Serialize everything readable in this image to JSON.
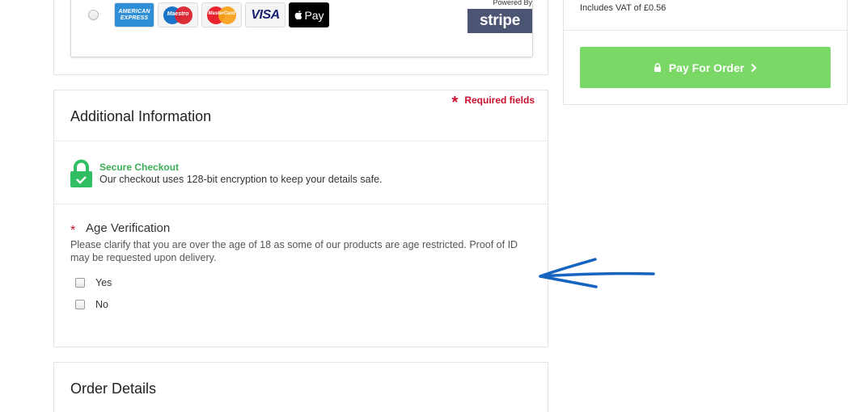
{
  "payment": {
    "cards": [
      {
        "name": "American Express",
        "line1": "AMERICAN",
        "line2": "EXPRESS"
      },
      {
        "name": "Maestro",
        "label": "Maestro"
      },
      {
        "name": "MasterCard",
        "label": "MasterCard"
      },
      {
        "name": "Visa",
        "label": "VISA"
      },
      {
        "name": "Apple Pay",
        "label": "Pay"
      }
    ],
    "powered_by": "Powered By",
    "stripe_label": "stripe"
  },
  "summary": {
    "vat_text": "Includes VAT of £0.56",
    "pay_button": "Pay For Order"
  },
  "additional_info": {
    "title": "Additional Information",
    "required_text": "Required fields",
    "secure_title": "Secure Checkout",
    "secure_text": "Our checkout uses 128-bit encryption to keep your details safe.",
    "age_title": "Age Verification",
    "age_description": "Please clarify that you are over the age of 18 as some of our products are age restricted. Proof of ID may be requested upon delivery.",
    "options": [
      {
        "label": "Yes",
        "checked": false
      },
      {
        "label": "No",
        "checked": false
      }
    ]
  },
  "order_details": {
    "title": "Order Details"
  },
  "colors": {
    "pay_button": "#7ad866",
    "secure_green": "#3aad55",
    "required_red": "#c8102e",
    "annotation_arrow": "#1565c0",
    "stripe_bg": "#4b5573"
  }
}
